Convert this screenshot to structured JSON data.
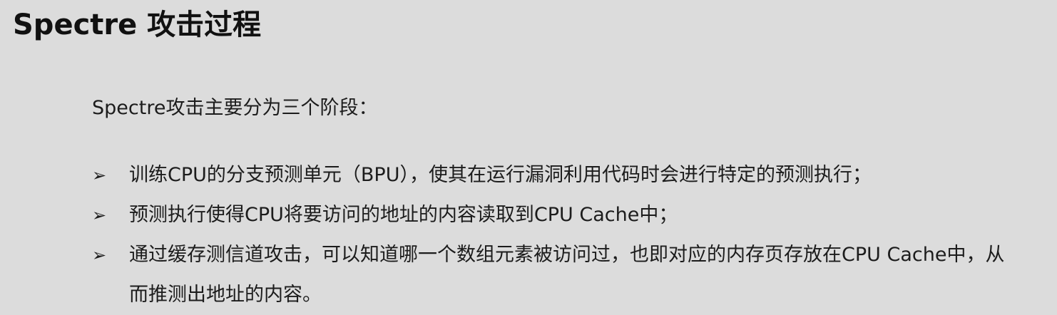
{
  "slide": {
    "title": "Spectre 攻击过程",
    "intro": "Spectre攻击主要分为三个阶段：",
    "bullet_marker": "➢",
    "bullets": [
      {
        "text": "训练CPU的分支预测单元（BPU），使其在运行漏洞利用代码时会进行特定的预测执行；"
      },
      {
        "text": "预测执行使得CPU将要访问的地址的内容读取到CPU Cache中；"
      },
      {
        "text": "通过缓存测信道攻击，可以知道哪一个数组元素被访问过，也即对应的内存页存放在CPU Cache中，从而推测出地址的内容。"
      }
    ]
  }
}
